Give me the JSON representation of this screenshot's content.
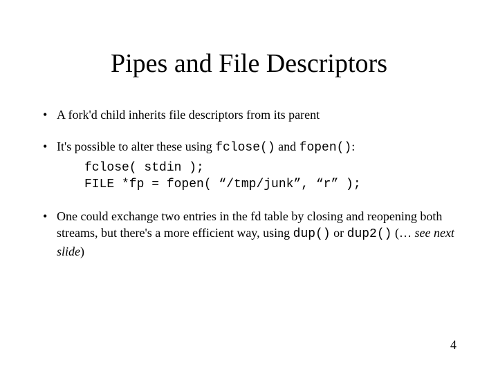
{
  "title": "Pipes and File Descriptors",
  "bullets": {
    "b1": "A fork'd child inherits file descriptors from its parent",
    "b2": {
      "pre": "It's possible to alter these using ",
      "fn1": "fclose()",
      "mid": " and ",
      "fn2": "fopen()",
      "post": ":",
      "code1": "fclose( stdin );",
      "code2": "FILE *fp = fopen( “/tmp/junk”, “r” );"
    },
    "b3": {
      "pre": "One could exchange two entries in the fd table by closing and reopening both streams, but there's a more efficient way, using ",
      "fn1": "dup()",
      "mid": " or ",
      "fn2": "dup2()",
      "paren_open": " (",
      "ellipsis": "… ",
      "note": "see next slide",
      "paren_close": ")"
    }
  },
  "page_number": "4"
}
